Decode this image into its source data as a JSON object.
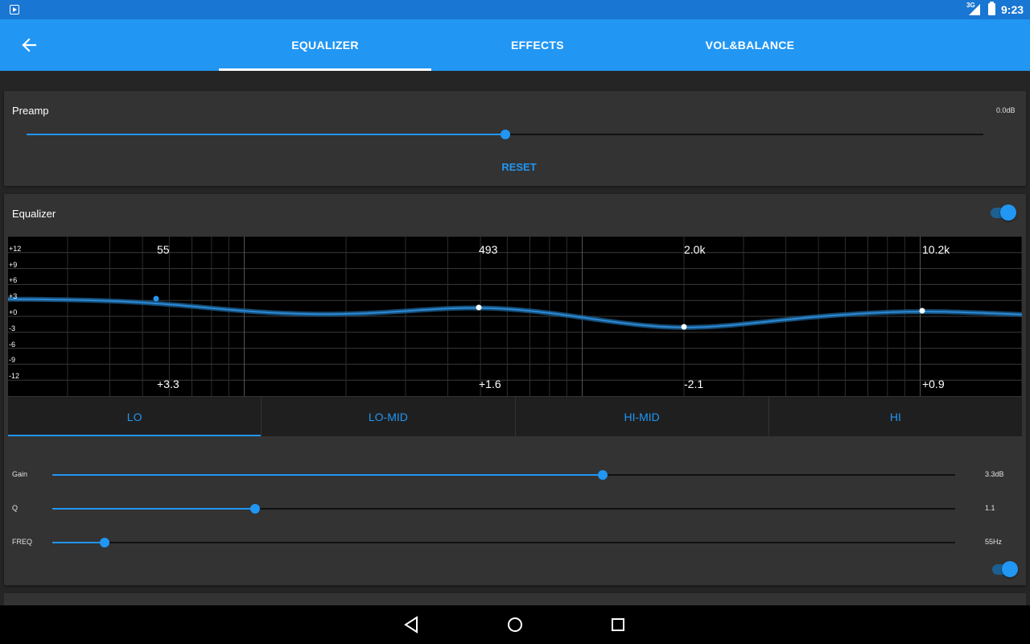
{
  "status_bar": {
    "network": "3G",
    "time": "9:23"
  },
  "tabs": [
    {
      "label": "EQUALIZER",
      "active": true
    },
    {
      "label": "EFFECTS",
      "active": false
    },
    {
      "label": "VOL&BALANCE",
      "active": false
    }
  ],
  "preamp": {
    "title": "Preamp",
    "value": "0.0dB",
    "level": 0.5,
    "reset_label": "RESET"
  },
  "equalizer": {
    "title": "Equalizer",
    "enabled": true,
    "db_scale": [
      "+12",
      "+9",
      "+6",
      "+3",
      "+0",
      "-3",
      "-6",
      "-9",
      "-12"
    ],
    "bands": [
      {
        "freq": "55",
        "gain": "+3.3"
      },
      {
        "freq": "493",
        "gain": "+1.6"
      },
      {
        "freq": "2.0k",
        "gain": "-2.1"
      },
      {
        "freq": "10.2k",
        "gain": "+0.9"
      }
    ],
    "band_tabs": [
      "LO",
      "LO-MID",
      "HI-MID",
      "HI"
    ],
    "selected_band": "LO",
    "params": [
      {
        "label": "Gain",
        "value": "3.3dB",
        "level": 0.61
      },
      {
        "label": "Q",
        "value": "1.1",
        "level": 0.225
      },
      {
        "label": "FREQ",
        "value": "55Hz",
        "level": 0.058
      }
    ],
    "band_enabled": true
  },
  "colors": {
    "accent": "#2196f3",
    "app_bar": "#2196f3",
    "status_bar": "#1976d2",
    "card": "#333333",
    "background": "#252525"
  },
  "icons": {
    "back": "arrow-back-icon",
    "nav_back": "triangle-back-icon",
    "nav_home": "circle-home-icon",
    "nav_recents": "square-recents-icon"
  }
}
